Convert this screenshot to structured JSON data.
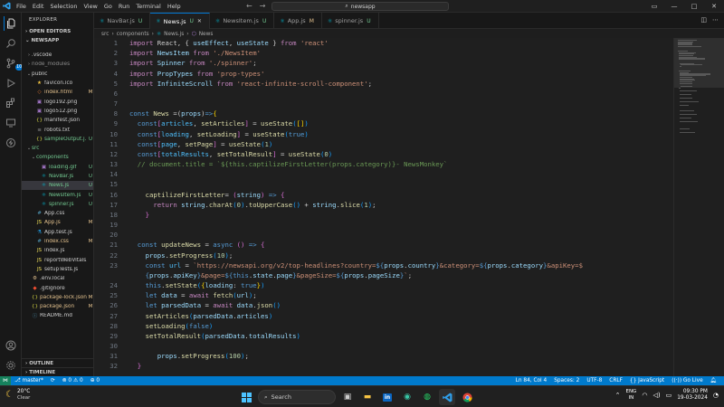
{
  "titlebar": {
    "menu": [
      "File",
      "Edit",
      "Selection",
      "View",
      "Go",
      "Run",
      "Terminal",
      "Help"
    ],
    "search": "newsapp"
  },
  "sidebar": {
    "title": "EXPLORER",
    "open_editors": "OPEN EDITORS",
    "root": "NEWSAPP",
    "outline": "OUTLINE",
    "timeline": "TIMELINE",
    "source_control_badge": "10",
    "tree": [
      {
        "name": ".vscode",
        "badge": "",
        "color": "#cccccc",
        "icon": "folder",
        "indent": 1,
        "chev": "›"
      },
      {
        "name": "node_modules",
        "badge": "",
        "color": "#8c8c8c",
        "icon": "folder",
        "indent": 1,
        "chev": "›"
      },
      {
        "name": "public",
        "badge": "",
        "color": "#cccccc",
        "icon": "folder",
        "indent": 1,
        "chev": "⌄"
      },
      {
        "name": "favicon.ico",
        "badge": "",
        "color": "#cccccc",
        "icon": "star",
        "indent": 2,
        "chev": ""
      },
      {
        "name": "index.html",
        "badge": "M",
        "color": "#e2c08d",
        "icon": "html",
        "indent": 2,
        "chev": ""
      },
      {
        "name": "logo192.png",
        "badge": "",
        "color": "#cccccc",
        "icon": "image",
        "indent": 2,
        "chev": ""
      },
      {
        "name": "logo512.png",
        "badge": "",
        "color": "#cccccc",
        "icon": "image",
        "indent": 2,
        "chev": ""
      },
      {
        "name": "manifest.json",
        "badge": "",
        "color": "#cccccc",
        "icon": "json",
        "indent": 2,
        "chev": ""
      },
      {
        "name": "robots.txt",
        "badge": "",
        "color": "#cccccc",
        "icon": "text",
        "indent": 2,
        "chev": ""
      },
      {
        "name": "sampleOutput.j...",
        "badge": "U",
        "color": "#73c991",
        "icon": "json",
        "indent": 2,
        "chev": ""
      },
      {
        "name": "src",
        "badge": "",
        "color": "#73c991",
        "icon": "folder",
        "indent": 1,
        "chev": "⌄"
      },
      {
        "name": "components",
        "badge": "",
        "color": "#73c991",
        "icon": "folder",
        "indent": 2,
        "chev": "⌄"
      },
      {
        "name": "loading.gif",
        "badge": "U",
        "color": "#73c991",
        "icon": "image",
        "indent": 3,
        "chev": ""
      },
      {
        "name": "NavBar.js",
        "badge": "U",
        "color": "#73c991",
        "icon": "react",
        "indent": 3,
        "chev": ""
      },
      {
        "name": "News.js",
        "badge": "U",
        "color": "#73c991",
        "icon": "react",
        "indent": 3,
        "chev": "",
        "selected": true
      },
      {
        "name": "NewsItem.js",
        "badge": "U",
        "color": "#73c991",
        "icon": "react",
        "indent": 3,
        "chev": ""
      },
      {
        "name": "spinner.js",
        "badge": "U",
        "color": "#73c991",
        "icon": "react",
        "indent": 3,
        "chev": ""
      },
      {
        "name": "App.css",
        "badge": "",
        "color": "#cccccc",
        "icon": "css",
        "indent": 2,
        "chev": ""
      },
      {
        "name": "App.js",
        "badge": "M",
        "color": "#e2c08d",
        "icon": "js",
        "indent": 2,
        "chev": ""
      },
      {
        "name": "App.test.js",
        "badge": "",
        "color": "#cccccc",
        "icon": "test",
        "indent": 2,
        "chev": ""
      },
      {
        "name": "index.css",
        "badge": "M",
        "color": "#e2c08d",
        "icon": "css",
        "indent": 2,
        "chev": ""
      },
      {
        "name": "index.js",
        "badge": "",
        "color": "#cccccc",
        "icon": "js",
        "indent": 2,
        "chev": ""
      },
      {
        "name": "reportWebVitals.js",
        "badge": "",
        "color": "#cccccc",
        "icon": "js",
        "indent": 2,
        "chev": ""
      },
      {
        "name": "setupTests.js",
        "badge": "",
        "color": "#cccccc",
        "icon": "js",
        "indent": 2,
        "chev": ""
      },
      {
        "name": ".env.local",
        "badge": "",
        "color": "#cccccc",
        "icon": "env",
        "indent": 1,
        "chev": ""
      },
      {
        "name": ".gitignore",
        "badge": "",
        "color": "#cccccc",
        "icon": "git",
        "indent": 1,
        "chev": ""
      },
      {
        "name": "package-lock.json",
        "badge": "M",
        "color": "#e2c08d",
        "icon": "json",
        "indent": 1,
        "chev": ""
      },
      {
        "name": "package.json",
        "badge": "M",
        "color": "#e2c08d",
        "icon": "json",
        "indent": 1,
        "chev": ""
      },
      {
        "name": "README.md",
        "badge": "",
        "color": "#cccccc",
        "icon": "info",
        "indent": 1,
        "chev": ""
      }
    ]
  },
  "tabs": [
    {
      "label": "NavBar.js",
      "badge": "U",
      "active": false
    },
    {
      "label": "News.js",
      "badge": "U",
      "active": true
    },
    {
      "label": "NewsItem.js",
      "badge": "U",
      "active": false
    },
    {
      "label": "App.js",
      "badge": "M",
      "active": false
    },
    {
      "label": "spinner.js",
      "badge": "U",
      "active": false
    }
  ],
  "breadcrumb": [
    "src",
    "components",
    "News.js",
    "News"
  ],
  "code": [
    {
      "n": "1",
      "t": [
        [
          "kw",
          "import"
        ],
        [
          "pu",
          " React, { "
        ],
        [
          "va",
          "useEffect"
        ],
        [
          "pu",
          ", "
        ],
        [
          "va",
          "useState"
        ],
        [
          "pu",
          " } "
        ],
        [
          "kw",
          "from"
        ],
        [
          "st",
          " 'react'"
        ]
      ]
    },
    {
      "n": "2",
      "t": [
        [
          "kw",
          "import"
        ],
        [
          "va",
          " NewsItem "
        ],
        [
          "kw",
          "from"
        ],
        [
          "st",
          " './NewsItem'"
        ]
      ]
    },
    {
      "n": "3",
      "t": [
        [
          "kw",
          "import"
        ],
        [
          "va",
          " Spinner "
        ],
        [
          "kw",
          "from"
        ],
        [
          "st",
          " './spinner'"
        ],
        [
          "pu",
          ";"
        ]
      ]
    },
    {
      "n": "4",
      "t": [
        [
          "kw",
          "import"
        ],
        [
          "va",
          " PropTypes "
        ],
        [
          "kw",
          "from"
        ],
        [
          "st",
          " 'prop-types'"
        ]
      ]
    },
    {
      "n": "5",
      "t": [
        [
          "kw",
          "import"
        ],
        [
          "va",
          " InfiniteScroll "
        ],
        [
          "kw",
          "from"
        ],
        [
          "st",
          " 'react-infinite-scroll-component'"
        ],
        [
          "pu",
          ";"
        ]
      ]
    },
    {
      "n": "6",
      "t": []
    },
    {
      "n": "7",
      "t": []
    },
    {
      "n": "8",
      "t": [
        [
          "kb",
          "const"
        ],
        [
          "fn",
          " News"
        ],
        [
          "pu",
          " =("
        ],
        [
          "va",
          "props"
        ],
        [
          "pu",
          ")"
        ],
        [
          "kb",
          "=>"
        ],
        [
          "br1",
          "{"
        ]
      ]
    },
    {
      "n": "9",
      "t": [
        [
          "pu",
          "  "
        ],
        [
          "kb",
          "const"
        ],
        [
          "br2",
          "["
        ],
        [
          "df",
          "articles"
        ],
        [
          "pu",
          ", "
        ],
        [
          "fn",
          "setArticles"
        ],
        [
          "br2",
          "]"
        ],
        [
          "pu",
          " = "
        ],
        [
          "fn",
          "useState"
        ],
        [
          "br3",
          "("
        ],
        [
          "br1",
          "[]"
        ],
        [
          "br3",
          ")"
        ]
      ]
    },
    {
      "n": "10",
      "t": [
        [
          "pu",
          "  "
        ],
        [
          "kb",
          "const"
        ],
        [
          "br2",
          "["
        ],
        [
          "df",
          "loading"
        ],
        [
          "pu",
          ", "
        ],
        [
          "fn",
          "setLoading"
        ],
        [
          "br2",
          "]"
        ],
        [
          "pu",
          " = "
        ],
        [
          "fn",
          "useState"
        ],
        [
          "br3",
          "("
        ],
        [
          "kb",
          "true"
        ],
        [
          "br3",
          ")"
        ]
      ]
    },
    {
      "n": "11",
      "t": [
        [
          "pu",
          "  "
        ],
        [
          "kb",
          "const"
        ],
        [
          "br2",
          "["
        ],
        [
          "df",
          "page"
        ],
        [
          "pu",
          ", "
        ],
        [
          "fn",
          "setPage"
        ],
        [
          "br2",
          "]"
        ],
        [
          "pu",
          " = "
        ],
        [
          "fn",
          "useState"
        ],
        [
          "br3",
          "("
        ],
        [
          "nu",
          "1"
        ],
        [
          "br3",
          ")"
        ]
      ]
    },
    {
      "n": "12",
      "t": [
        [
          "pu",
          "  "
        ],
        [
          "kb",
          "const"
        ],
        [
          "br2",
          "["
        ],
        [
          "df",
          "totalResults"
        ],
        [
          "pu",
          ", "
        ],
        [
          "fn",
          "setTotalResult"
        ],
        [
          "br2",
          "]"
        ],
        [
          "pu",
          " = "
        ],
        [
          "fn",
          "useState"
        ],
        [
          "br3",
          "("
        ],
        [
          "nu",
          "0"
        ],
        [
          "br3",
          ")"
        ]
      ]
    },
    {
      "n": "13",
      "t": [
        [
          "cm",
          "  // document.title = `${this.captilizeFirstLetter(props.category)}- NewsMonkey`"
        ]
      ]
    },
    {
      "n": "14",
      "t": []
    },
    {
      "n": "15",
      "t": []
    },
    {
      "n": "16",
      "t": [
        [
          "pu",
          "    "
        ],
        [
          "fn",
          "captilizeFirstLetter"
        ],
        [
          "pu",
          "= "
        ],
        [
          "br2",
          "("
        ],
        [
          "va",
          "string"
        ],
        [
          "br2",
          ")"
        ],
        [
          "kb",
          " =>"
        ],
        [
          "br2",
          " {"
        ]
      ]
    },
    {
      "n": "17",
      "t": [
        [
          "kw",
          "      return"
        ],
        [
          "va",
          " string"
        ],
        [
          "pu",
          "."
        ],
        [
          "fn",
          "charAt"
        ],
        [
          "br3",
          "("
        ],
        [
          "nu",
          "0"
        ],
        [
          "br3",
          ")"
        ],
        [
          "pu",
          "."
        ],
        [
          "fn",
          "toUpperCase"
        ],
        [
          "br3",
          "()"
        ],
        [
          "pu",
          " + "
        ],
        [
          "va",
          "string"
        ],
        [
          "pu",
          "."
        ],
        [
          "fn",
          "slice"
        ],
        [
          "br3",
          "("
        ],
        [
          "nu",
          "1"
        ],
        [
          "br3",
          ")"
        ],
        [
          "pu",
          ";"
        ]
      ]
    },
    {
      "n": "18",
      "t": [
        [
          "br2",
          "    }"
        ]
      ]
    },
    {
      "n": "19",
      "t": []
    },
    {
      "n": "20",
      "t": []
    },
    {
      "n": "21",
      "t": [
        [
          "pu",
          "  "
        ],
        [
          "kb",
          "const"
        ],
        [
          "fn",
          " updateNews"
        ],
        [
          "pu",
          " = "
        ],
        [
          "kb",
          "async"
        ],
        [
          "br2",
          " ()"
        ],
        [
          "kb",
          " =>"
        ],
        [
          "br2",
          " {"
        ]
      ]
    },
    {
      "n": "22",
      "t": [
        [
          "va",
          "    props"
        ],
        [
          "pu",
          "."
        ],
        [
          "fn",
          "setProgress"
        ],
        [
          "br3",
          "("
        ],
        [
          "nu",
          "10"
        ],
        [
          "br3",
          ")"
        ],
        [
          "pu",
          ";"
        ]
      ]
    },
    {
      "n": "23",
      "t": [
        [
          "kb",
          "    const"
        ],
        [
          "df",
          " url"
        ],
        [
          "pu",
          " = "
        ],
        [
          "st",
          "`https://newsapi.org/v2/top-headlines?country="
        ],
        [
          "kb",
          "${"
        ],
        [
          "va",
          "props"
        ],
        [
          "pu",
          "."
        ],
        [
          "va",
          "country"
        ],
        [
          "kb",
          "}"
        ],
        [
          "st",
          "&category="
        ],
        [
          "kb",
          "${"
        ],
        [
          "va",
          "props"
        ],
        [
          "pu",
          "."
        ],
        [
          "va",
          "category"
        ],
        [
          "kb",
          "}"
        ],
        [
          "st",
          "&apiKey=$"
        ]
      ]
    },
    {
      "n": "",
      "t": [
        [
          "kb",
          "    {"
        ],
        [
          "va",
          "props"
        ],
        [
          "pu",
          "."
        ],
        [
          "va",
          "apiKey"
        ],
        [
          "kb",
          "}"
        ],
        [
          "st",
          "&page="
        ],
        [
          "kb",
          "${"
        ],
        [
          "kb",
          "this"
        ],
        [
          "pu",
          "."
        ],
        [
          "va",
          "state"
        ],
        [
          "pu",
          "."
        ],
        [
          "va",
          "page"
        ],
        [
          "kb",
          "}"
        ],
        [
          "st",
          "&pageSize="
        ],
        [
          "kb",
          "${"
        ],
        [
          "va",
          "props"
        ],
        [
          "pu",
          "."
        ],
        [
          "va",
          "pageSize"
        ],
        [
          "kb",
          "}"
        ],
        [
          "st",
          "`"
        ],
        [
          "pu",
          ";"
        ]
      ]
    },
    {
      "n": "24",
      "t": [
        [
          "kb",
          "    this"
        ],
        [
          "pu",
          "."
        ],
        [
          "fn",
          "setState"
        ],
        [
          "br3",
          "("
        ],
        [
          "br1",
          "{"
        ],
        [
          "va",
          "loading"
        ],
        [
          "pu",
          ": "
        ],
        [
          "kb",
          "true"
        ],
        [
          "br1",
          "}"
        ],
        [
          "br3",
          ")"
        ]
      ]
    },
    {
      "n": "25",
      "t": [
        [
          "kb",
          "    let"
        ],
        [
          "va",
          " data"
        ],
        [
          "pu",
          " = "
        ],
        [
          "kw",
          "await"
        ],
        [
          "fn",
          " fetch"
        ],
        [
          "br3",
          "("
        ],
        [
          "va",
          "url"
        ],
        [
          "br3",
          ")"
        ],
        [
          "pu",
          ";"
        ]
      ]
    },
    {
      "n": "26",
      "t": [
        [
          "kb",
          "    let"
        ],
        [
          "va",
          " parsedData"
        ],
        [
          "pu",
          " = "
        ],
        [
          "kw",
          "await"
        ],
        [
          "va",
          " data"
        ],
        [
          "pu",
          "."
        ],
        [
          "fn",
          "json"
        ],
        [
          "br3",
          "()"
        ]
      ]
    },
    {
      "n": "27",
      "t": [
        [
          "fn",
          "    setArticles"
        ],
        [
          "br3",
          "("
        ],
        [
          "va",
          "parsedData"
        ],
        [
          "pu",
          "."
        ],
        [
          "va",
          "articles"
        ],
        [
          "br3",
          ")"
        ]
      ]
    },
    {
      "n": "28",
      "t": [
        [
          "fn",
          "    setLoading"
        ],
        [
          "br3",
          "("
        ],
        [
          "kb",
          "false"
        ],
        [
          "br3",
          ")"
        ]
      ]
    },
    {
      "n": "29",
      "t": [
        [
          "fn",
          "    setTotalResult"
        ],
        [
          "br3",
          "("
        ],
        [
          "va",
          "parsedData"
        ],
        [
          "pu",
          "."
        ],
        [
          "va",
          "totalResults"
        ],
        [
          "br3",
          ")"
        ]
      ]
    },
    {
      "n": "30",
      "t": []
    },
    {
      "n": "31",
      "t": [
        [
          "va",
          "       props"
        ],
        [
          "pu",
          "."
        ],
        [
          "fn",
          "setProgress"
        ],
        [
          "br3",
          "("
        ],
        [
          "nu",
          "100"
        ],
        [
          "br3",
          ")"
        ],
        [
          "pu",
          ";"
        ]
      ]
    },
    {
      "n": "32",
      "t": [
        [
          "br2",
          "  }"
        ]
      ]
    }
  ],
  "statusbar": {
    "branch": "master*",
    "sync": "⟳",
    "errors": "⊗ 0 ⚠ 0",
    "ports": "⊕ 0",
    "position": "Ln 84, Col 4",
    "spaces": "Spaces: 2",
    "encoding": "UTF-8",
    "eol": "CRLF",
    "language": "{} JavaScript",
    "golive": "Go Live"
  },
  "taskbar": {
    "temp": "20°C",
    "condition": "Clear",
    "search": "Search",
    "lang1": "ENG",
    "lang2": "IN",
    "time": "09:30 PM",
    "date": "19-03-2024"
  }
}
